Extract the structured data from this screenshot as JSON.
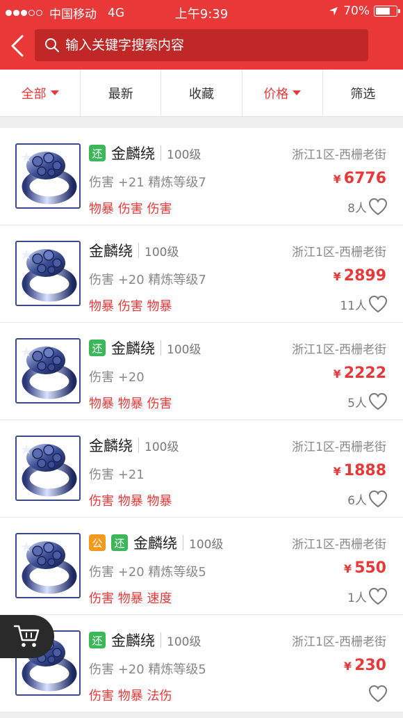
{
  "status_bar": {
    "carrier": "中国移动",
    "network": "4G",
    "time": "上午9:39",
    "battery": "70%",
    "battery_level": 0.7
  },
  "search": {
    "placeholder": "输入关键字搜索内容"
  },
  "filters": [
    {
      "label": "全部",
      "active": true,
      "dropdown": true
    },
    {
      "label": "最新",
      "active": false,
      "dropdown": false
    },
    {
      "label": "收藏",
      "active": false,
      "dropdown": false
    },
    {
      "label": "价格",
      "active": true,
      "dropdown": true
    },
    {
      "label": "筛选",
      "active": false,
      "dropdown": false
    }
  ],
  "items": [
    {
      "tags": [
        "还"
      ],
      "name": "金麟绕",
      "level": "100级",
      "server": "浙江1区-西栅老街",
      "stats": "伤害 +21 精炼等级7",
      "currency": "¥",
      "price": "6776",
      "attrs": "物暴 伤害 伤害",
      "likes": "8人"
    },
    {
      "tags": [],
      "name": "金麟绕",
      "level": "100级",
      "server": "浙江1区-西栅老街",
      "stats": "伤害 +20 精炼等级7",
      "currency": "¥",
      "price": "2899",
      "attrs": "物暴 伤害 物暴",
      "likes": "11人"
    },
    {
      "tags": [
        "还"
      ],
      "name": "金麟绕",
      "level": "100级",
      "server": "浙江1区-西栅老街",
      "stats": "伤害 +20",
      "currency": "¥",
      "price": "2222",
      "attrs": "物暴 物暴 伤害",
      "likes": "5人"
    },
    {
      "tags": [],
      "name": "金麟绕",
      "level": "100级",
      "server": "浙江1区-西栅老街",
      "stats": "伤害 +21",
      "currency": "¥",
      "price": "1888",
      "attrs": "伤害 物暴 物暴",
      "likes": "6人"
    },
    {
      "tags": [
        "公",
        "还"
      ],
      "name": "金麟绕",
      "level": "100级",
      "server": "浙江1区-西栅老街",
      "stats": "伤害 +20 精炼等级5",
      "currency": "¥",
      "price": "550",
      "attrs": "伤害 物暴 速度",
      "likes": "1人"
    },
    {
      "tags": [
        "还"
      ],
      "name": "金麟绕",
      "level": "100级",
      "server": "浙江1区-西栅老街",
      "stats": "伤害 +20 精炼等级5",
      "currency": "¥",
      "price": "230",
      "attrs": "伤害 物暴 法伤",
      "likes": ""
    }
  ],
  "icons": {
    "back": "chevron-left-icon",
    "search": "search-icon",
    "cart": "cart-icon",
    "heart": "heart-icon",
    "location": "location-arrow-icon"
  },
  "colors": {
    "brand_red": "#e83838",
    "tag_green": "#3cb85b",
    "tag_orange": "#f29a1c"
  }
}
